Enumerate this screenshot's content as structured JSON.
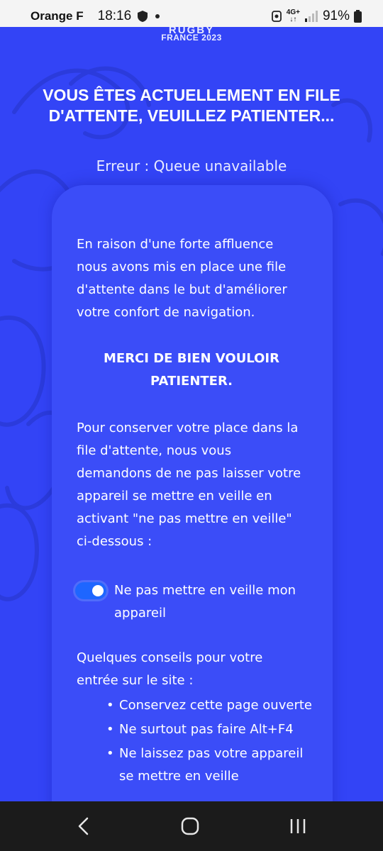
{
  "status_bar": {
    "carrier": "Orange F",
    "time": "18:16",
    "network": "4G+",
    "battery": "91%"
  },
  "logo": {
    "line1": "RUGBY",
    "line2": "FRANCE 2023"
  },
  "headline": "VOUS ÊTES ACTUELLEMENT EN FILE D'ATTENTE, VEUILLEZ PATIENTER...",
  "error": "Erreur : Queue unavailable",
  "card": {
    "paragraph1": "En raison d'une forte affluence nous avons mis en place une file d'attente dans le but d'améliorer votre confort de navigation.",
    "merci": "MERCI DE BIEN VOULOIR PATIENTER.",
    "paragraph2": "Pour conserver votre place dans la file d'attente, nous vous demandons de ne pas laisser votre appareil se mettre en veille en activant \"ne pas mettre en veille\" ci-dessous :",
    "toggle": {
      "label": "Ne pas mettre en veille mon appareil",
      "checked": true
    },
    "tips_intro": "Quelques conseils pour votre entrée sur le site :",
    "tips": [
      "Conservez cette page ouverte",
      "Ne surtout pas faire Alt+F4",
      "Ne laissez pas votre appareil se mettre en veille"
    ]
  },
  "colors": {
    "background": "#3344f6",
    "card": "#3b4df8",
    "toggle": "#1e66ff"
  },
  "nav_bar": {
    "icons": [
      "back-icon",
      "home-icon",
      "recent-apps-icon"
    ]
  }
}
